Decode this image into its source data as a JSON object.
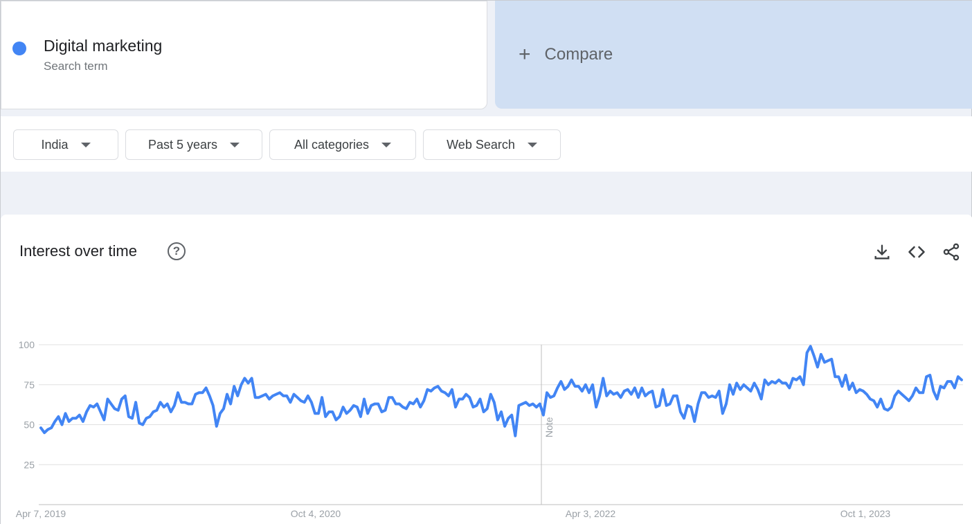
{
  "search_term": {
    "name": "Digital marketing",
    "type_label": "Search term",
    "color": "#4285f4"
  },
  "compare": {
    "label": "Compare",
    "icon": "plus-icon"
  },
  "filters": {
    "region": "India",
    "time_range": "Past 5 years",
    "category": "All categories",
    "search_type": "Web Search"
  },
  "chart_card": {
    "title": "Interest over time",
    "tools": [
      "download-icon",
      "embed-code-icon",
      "share-icon"
    ]
  },
  "chart_data": {
    "type": "line",
    "series": [
      {
        "color": "#4285f4",
        "values": [
          48,
          45,
          47,
          48,
          52,
          55,
          50,
          57,
          52,
          54,
          54,
          56,
          52,
          58,
          62,
          61,
          63,
          58,
          53,
          66,
          63,
          60,
          59,
          66,
          68,
          55,
          54,
          64,
          51,
          50,
          54,
          55,
          58,
          59,
          64,
          61,
          63,
          58,
          62,
          70,
          64,
          64,
          63,
          63,
          69,
          70,
          70,
          73,
          68,
          62,
          49,
          57,
          60,
          69,
          63,
          74,
          68,
          75,
          79,
          76,
          79,
          67,
          67,
          68,
          69,
          66,
          68,
          69,
          70,
          68,
          68,
          64,
          69,
          67,
          65,
          64,
          68,
          64,
          57,
          57,
          67,
          55,
          58,
          58,
          53,
          55,
          61,
          57,
          59,
          62,
          61,
          55,
          66,
          57,
          62,
          63,
          63,
          58,
          59,
          67,
          67,
          63,
          63,
          61,
          60,
          64,
          63,
          66,
          61,
          65,
          72,
          71,
          73,
          74,
          71,
          70,
          68,
          72,
          61,
          66,
          66,
          69,
          67,
          61,
          62,
          66,
          58,
          60,
          69,
          64,
          53,
          58,
          49,
          54,
          56,
          43,
          62,
          63,
          64,
          62,
          63,
          61,
          63,
          56,
          70,
          67,
          68,
          73,
          77,
          72,
          74,
          78,
          74,
          74,
          71,
          75,
          70,
          75,
          61,
          68,
          79,
          68,
          71,
          69,
          70,
          67,
          71,
          72,
          69,
          73,
          67,
          73,
          68,
          70,
          71,
          61,
          62,
          72,
          62,
          63,
          68,
          68,
          58,
          54,
          62,
          61,
          52,
          63,
          70,
          70,
          67,
          68,
          67,
          71,
          57,
          63,
          75,
          69,
          76,
          72,
          75,
          73,
          71,
          76,
          72,
          66,
          78,
          75,
          77,
          76,
          78,
          76,
          76,
          73,
          79,
          78,
          80,
          75,
          95,
          99,
          93,
          86,
          94,
          89,
          90,
          91,
          80,
          80,
          74,
          81,
          72,
          76,
          70,
          72,
          71,
          69,
          66,
          65,
          61,
          66,
          60,
          59,
          61,
          68,
          71,
          69,
          67,
          65,
          68,
          73,
          70,
          70,
          80,
          81,
          71,
          66,
          74,
          73,
          77,
          77,
          73,
          80,
          78
        ]
      }
    ],
    "x_tick_labels": [
      "Apr 7, 2019",
      "Oct 4, 2020",
      "Apr 3, 2022",
      "Oct 1, 2023"
    ],
    "y_ticks": [
      25,
      50,
      75,
      100
    ],
    "ylim": [
      0,
      100
    ],
    "annotation": "Note",
    "grid": true
  }
}
